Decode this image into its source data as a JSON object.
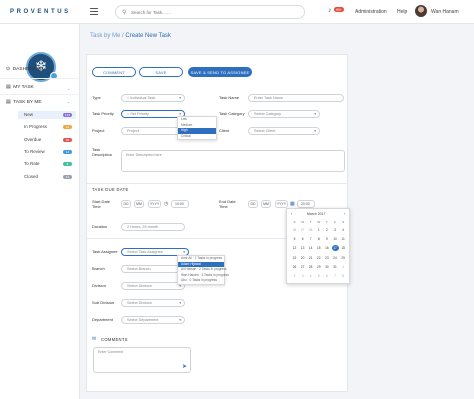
{
  "header": {
    "logo": "PROVENTUS",
    "search_placeholder": "Search for Task.......",
    "notification_count": "99+",
    "admin": "Administration",
    "help": "Help",
    "user_name": "Wan Hanam"
  },
  "sidebar": {
    "dashboard": "DASHBOARD",
    "my_task": "MY TASK",
    "task_by_me": "TASK BY ME",
    "items": [
      {
        "label": "New",
        "count": "123",
        "color": "#8e6fd8"
      },
      {
        "label": "In Progress",
        "count": "14",
        "color": "#f0a742"
      },
      {
        "label": "Overdue",
        "count": "32",
        "color": "#e0574f"
      },
      {
        "label": "To Review",
        "count": "14",
        "color": "#3f9bd8"
      },
      {
        "label": "To Rate",
        "count": "8",
        "color": "#42c0a0"
      },
      {
        "label": "Closed",
        "count": "12",
        "color": "#9aa3ad"
      }
    ]
  },
  "breadcrumb": {
    "parent": "Task by Me",
    "separator": " / ",
    "current": "Create New Task"
  },
  "buttons": {
    "comment": "COMMENT",
    "save": "SAVE",
    "save_send": "SAVE & SEND TO ASSIGNEE"
  },
  "form": {
    "type_label": "Type",
    "type_value": "Individual Task",
    "task_priority_label": "Task Priority",
    "task_priority_value": "Set Priority",
    "priority_options": [
      "Low",
      "Medium",
      "High",
      "Critical"
    ],
    "priority_selected": 2,
    "project_label": "Project",
    "project_value": "Project",
    "task_name_label": "Task Name",
    "task_name_placeholder": "Enter Task Name",
    "task_category_label": "Task Category",
    "task_category_value": "Select Category",
    "client_label": "Client",
    "client_value": "Select Client",
    "task_description_label": "Task Description",
    "task_description_placeholder": "Enter Description here"
  },
  "due_date": {
    "section": "TASK DUE DATE",
    "start_label": "Start Date Time",
    "start_dd": "DD",
    "start_mm": "MM",
    "start_yyyy": "YYYY",
    "start_time": "10:00",
    "end_label": "End Date Time",
    "end_dd": "DD",
    "end_mm": "MM",
    "end_yyyy": "YYYY",
    "end_time": "20:00",
    "duration_label": "Duration",
    "duration_placeholder": "2 Hours, 25 month"
  },
  "calendar": {
    "month": "March 2017",
    "days_of_week": [
      "S",
      "M",
      "T",
      "W",
      "T",
      "F",
      "S"
    ],
    "weeks": [
      [
        "26",
        "27",
        "28",
        "1",
        "2",
        "3",
        "4"
      ],
      [
        "5",
        "6",
        "7",
        "8",
        "9",
        "10",
        "11"
      ],
      [
        "12",
        "13",
        "14",
        "15",
        "16",
        "17",
        "18"
      ],
      [
        "19",
        "20",
        "21",
        "22",
        "23",
        "24",
        "25"
      ],
      [
        "26",
        "27",
        "28",
        "29",
        "30",
        "31",
        "1"
      ],
      [
        "2",
        "3",
        "4",
        "5",
        "6",
        "7",
        "8"
      ]
    ],
    "today": "17"
  },
  "assign": {
    "assignee_label": "Task Assignee",
    "assignee_value": "Select Task Assignee",
    "assignee_options": [
      {
        "name": "Amir Ali",
        "meta": "2 Tasks in progress"
      },
      {
        "name": "Adam Hijawat",
        "meta": ""
      },
      {
        "name": "Ali Hassan",
        "meta": "2 Tasks in progress"
      },
      {
        "name": "Wan Hanam",
        "meta": "3 Tasks in progress"
      },
      {
        "name": "Abu",
        "meta": "0 Tasks in progress"
      }
    ],
    "assignee_selected": 1,
    "branch_label": "Branch",
    "branch_value": "Select Branch",
    "division_label": "Division",
    "division_value": "Select Division",
    "subdivision_label": "Sub Division",
    "subdivision_value": "Select Division",
    "department_label": "Department",
    "department_value": "Select Department"
  },
  "comments": {
    "section": "COMMENTS",
    "placeholder": "Enter Comment"
  }
}
